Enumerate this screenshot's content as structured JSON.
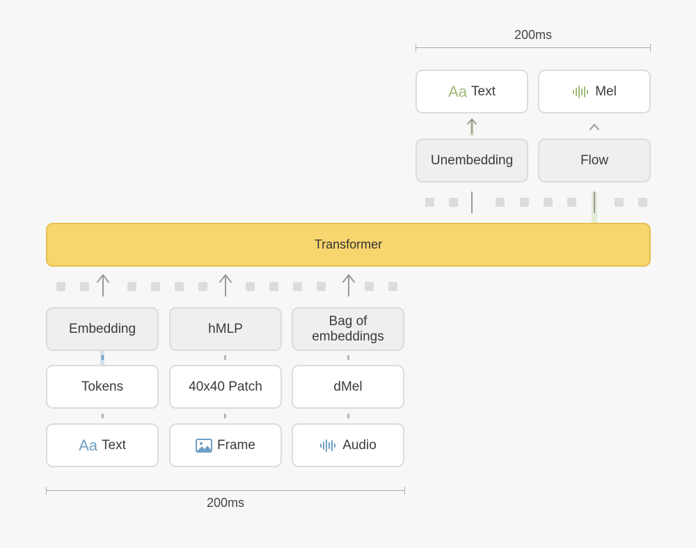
{
  "top_dimension": {
    "label": "200ms"
  },
  "bottom_dimension": {
    "label": "200ms"
  },
  "outputs": {
    "text": {
      "icon_label": "Aa",
      "label": "Text"
    },
    "mel": {
      "icon": "waveform-icon",
      "label": "Mel"
    }
  },
  "decoders": {
    "unembedding": "Unembedding",
    "flow": "Flow"
  },
  "transformer": {
    "label": "Transformer"
  },
  "encoders": {
    "embedding": "Embedding",
    "hmlp": "hMLP",
    "bag": "Bag of\nembeddings"
  },
  "representations": {
    "tokens": "Tokens",
    "patch": "40x40 Patch",
    "dmel": "dMel"
  },
  "inputs": {
    "text": {
      "icon_label": "Aa",
      "label": "Text"
    },
    "frame": {
      "icon": "image-icon",
      "label": "Frame"
    },
    "audio": {
      "icon": "waveform-icon",
      "label": "Audio"
    }
  },
  "colors": {
    "transformer_fill": "#f8d66e",
    "text_output_accent": "#9fba78",
    "text_input_accent": "#6f9fc4",
    "box_border": "#dcdcdc"
  }
}
